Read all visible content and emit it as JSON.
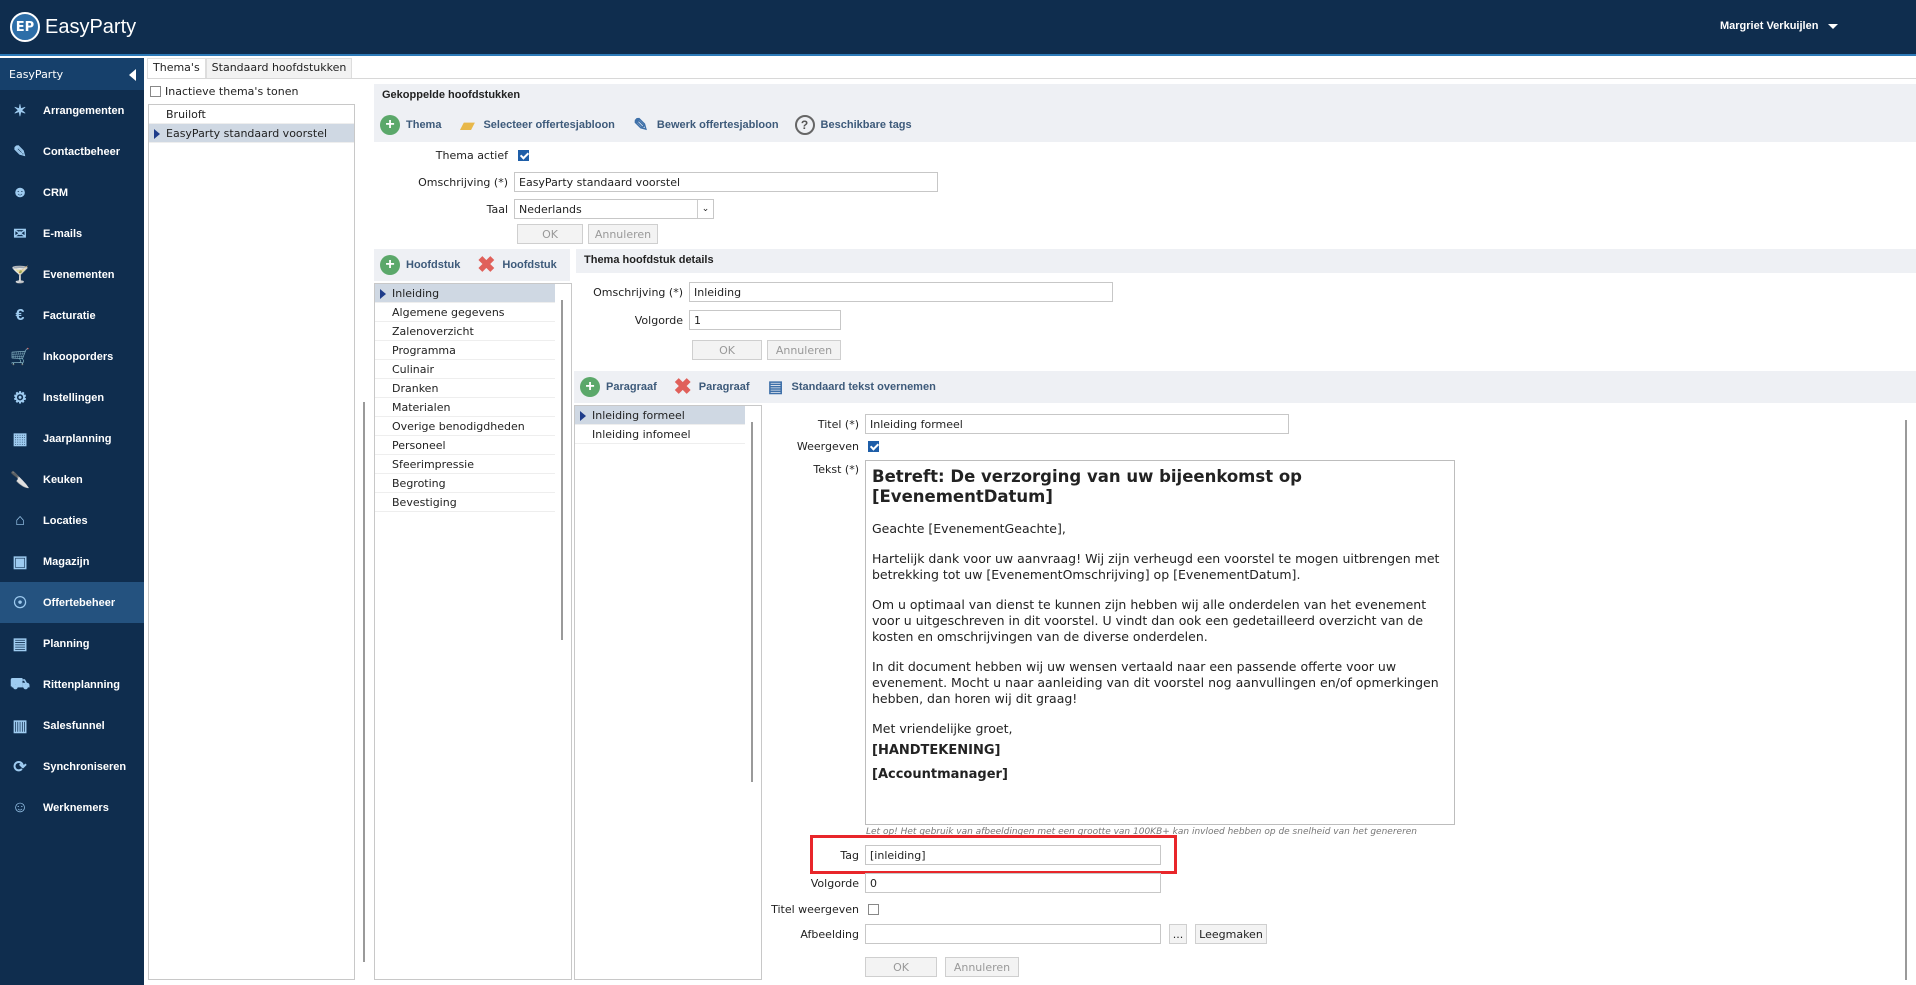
{
  "app": {
    "logo_badge": "EP",
    "logo_text": "EasyParty",
    "user": "Margriet Verkuijlen"
  },
  "sidebar": {
    "header": "EasyParty",
    "items": [
      {
        "label": "Arrangementen",
        "icon": "arrangements-icon",
        "glyph": "✶"
      },
      {
        "label": "Contactbeheer",
        "icon": "contacts-icon",
        "glyph": "✎"
      },
      {
        "label": "CRM",
        "icon": "crm-icon",
        "glyph": "☻"
      },
      {
        "label": "E-mails",
        "icon": "mail-icon",
        "glyph": "✉"
      },
      {
        "label": "Evenementen",
        "icon": "cocktail-icon",
        "glyph": "🍸"
      },
      {
        "label": "Facturatie",
        "icon": "invoice-icon",
        "glyph": "€"
      },
      {
        "label": "Inkooporders",
        "icon": "cart-icon",
        "glyph": "🛒"
      },
      {
        "label": "Instellingen",
        "icon": "settings-icon",
        "glyph": "⚙"
      },
      {
        "label": "Jaarplanning",
        "icon": "calendar-icon",
        "glyph": "▦"
      },
      {
        "label": "Keuken",
        "icon": "knife-icon",
        "glyph": "🔪"
      },
      {
        "label": "Locaties",
        "icon": "location-icon",
        "glyph": "⌂"
      },
      {
        "label": "Magazijn",
        "icon": "box-icon",
        "glyph": "▣"
      },
      {
        "label": "Offertebeheer",
        "icon": "quote-icon",
        "glyph": "☉",
        "active": true
      },
      {
        "label": "Planning",
        "icon": "planning-icon",
        "glyph": "▤"
      },
      {
        "label": "Rittenplanning",
        "icon": "truck-icon",
        "glyph": "⛟"
      },
      {
        "label": "Salesfunnel",
        "icon": "funnel-icon",
        "glyph": "▥"
      },
      {
        "label": "Synchroniseren",
        "icon": "sync-icon",
        "glyph": "⟳"
      },
      {
        "label": "Werknemers",
        "icon": "employee-icon",
        "glyph": "☺"
      }
    ]
  },
  "tabs": [
    {
      "label": "Thema's"
    },
    {
      "label": "Standaard hoofdstukken"
    }
  ],
  "themes": {
    "inactive_label": "Inactieve thema's tonen",
    "items": [
      "Bruiloft",
      "EasyParty standaard voorstel"
    ],
    "selected": 1
  },
  "linked": {
    "title": "Gekoppelde hoofdstukken",
    "toolbar": {
      "thema": "Thema",
      "select_template": "Selecteer offertesjabloon",
      "edit_template": "Bewerk offertesjabloon",
      "tags": "Beschikbare tags"
    },
    "active_label": "Thema actief",
    "desc_label": "Omschrijving (*)",
    "desc_value": "EasyParty standaard voorstel",
    "lang_label": "Taal",
    "lang_value": "Nederlands",
    "ok": "OK",
    "cancel": "Annuleren"
  },
  "chapters": {
    "add": "Hoofdstuk",
    "remove": "Hoofdstuk",
    "items": [
      "Inleiding",
      "Algemene gegevens",
      "Zalenoverzicht",
      "Programma",
      "Culinair",
      "Dranken",
      "Materialen",
      "Overige benodigdheden",
      "Personeel",
      "Sfeerimpressie",
      "Begroting",
      "Bevestiging"
    ],
    "selected": 0
  },
  "chapter_details": {
    "title": "Thema hoofdstuk details",
    "desc_label": "Omschrijving (*)",
    "desc_value": "Inleiding",
    "order_label": "Volgorde",
    "order_value": "1",
    "ok": "OK",
    "cancel": "Annuleren"
  },
  "paragraphs": {
    "add": "Paragraaf",
    "remove": "Paragraaf",
    "copy_text": "Standaard tekst overnemen",
    "items": [
      "Inleiding formeel",
      "Inleiding infomeel"
    ],
    "selected": 0
  },
  "paragraph_form": {
    "title_label": "Titel (*)",
    "title_value": "Inleiding formeel",
    "show_label": "Weergeven",
    "text_label": "Tekst (*)",
    "text": {
      "heading": "Betreft: De verzorging van uw bijeenkomst op [EvenementDatum]",
      "p1": "Geachte [EvenementGeachte],",
      "p2": "Hartelijk dank voor uw aanvraag! Wij zijn verheugd een voorstel te mogen uitbrengen met betrekking tot uw [EvenementOmschrijving] op [EvenementDatum].",
      "p3": "Om u optimaal van dienst te kunnen zijn hebben wij alle onderdelen van het evenement voor u uitgeschreven in dit voorstel. U vindt dan ook een gedetailleerd overzicht van de kosten en omschrijvingen van de diverse onderdelen.",
      "p4": "In dit document hebben wij uw wensen vertaald naar een passende offerte voor uw evenement. Mocht u naar aanleiding van dit voorstel nog aanvullingen en/of opmerkingen hebben, dan horen wij dit graag!",
      "p5": "Met vriendelijke groet,",
      "sig": "[HANDTEKENING]",
      "manager": "[Accountmanager]"
    },
    "note": "Let op! Het gebruik van afbeeldingen met een grootte van 100KB+ kan invloed hebben op de snelheid van het genereren",
    "tag_label": "Tag",
    "tag_value": "[inleiding]",
    "order_label": "Volgorde",
    "order_value": "0",
    "title_show_label": "Titel weergeven",
    "image_label": "Afbeelding",
    "browse": "...",
    "clear": "Leegmaken",
    "ok": "OK",
    "cancel": "Annuleren"
  },
  "highlight_color": "#e8262a"
}
